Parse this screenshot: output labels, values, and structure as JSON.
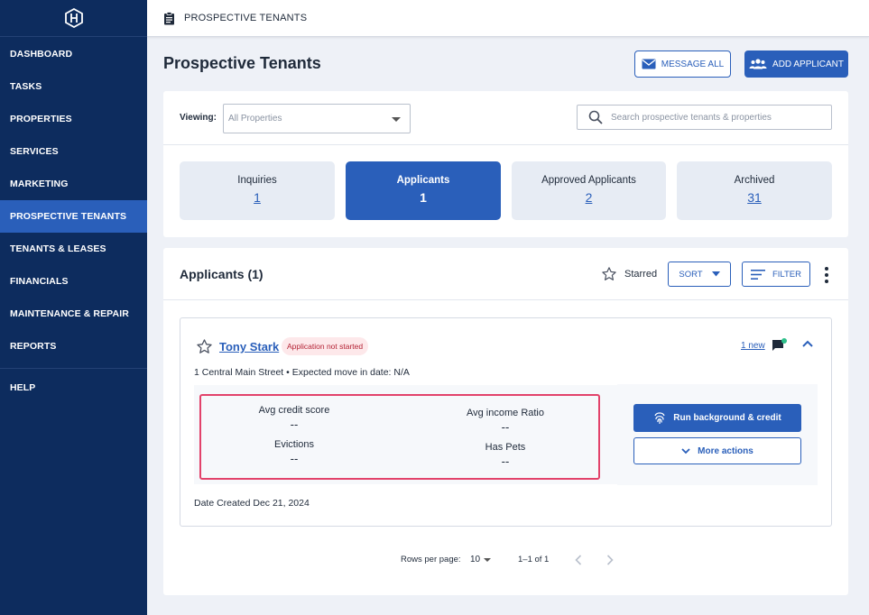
{
  "sidebar": {
    "items": [
      {
        "label": "DASHBOARD"
      },
      {
        "label": "TASKS"
      },
      {
        "label": "PROPERTIES"
      },
      {
        "label": "SERVICES"
      },
      {
        "label": "MARKETING"
      },
      {
        "label": "PROSPECTIVE TENANTS",
        "active": true
      },
      {
        "label": "TENANTS & LEASES"
      },
      {
        "label": "FINANCIALS"
      },
      {
        "label": "MAINTENANCE & REPAIR"
      },
      {
        "label": "REPORTS"
      }
    ],
    "help": "HELP"
  },
  "topbar": {
    "title": "PROSPECTIVE TENANTS"
  },
  "header": {
    "title": "Prospective Tenants",
    "message_all": "MESSAGE ALL",
    "add_applicant": "ADD APPLICANT"
  },
  "filters": {
    "viewing_label": "Viewing:",
    "viewing_value": "All Properties",
    "search_placeholder": "Search prospective tenants & properties"
  },
  "tabs": [
    {
      "label": "Inquiries",
      "count": "1"
    },
    {
      "label": "Applicants",
      "count": "1",
      "active": true
    },
    {
      "label": "Approved Applicants",
      "count": "2"
    },
    {
      "label": "Archived",
      "count": "31"
    }
  ],
  "applicants_section": {
    "title": "Applicants (1)",
    "starred": "Starred",
    "sort": "SORT",
    "filter": "FILTER"
  },
  "applicant": {
    "name": "Tony Stark",
    "status": "Application not started",
    "new_messages": "1 new",
    "address": "1 Central Main Street • Expected move in date: N/A",
    "stats": {
      "credit_label": "Avg credit score",
      "credit_value": "--",
      "evictions_label": "Evictions",
      "evictions_value": "--",
      "income_label": "Avg income Ratio",
      "income_value": "--",
      "pets_label": "Has Pets",
      "pets_value": "--"
    },
    "run_label": "Run background & credit",
    "more_label": "More actions",
    "date_created": "Date Created Dec 21, 2024"
  },
  "pagination": {
    "rows_label": "Rows per page:",
    "rows_value": "10",
    "range": "1–1 of 1"
  },
  "colors": {
    "sidebar": "#0d2c5e",
    "accent": "#2a5fba",
    "highlight": "#e2426a"
  }
}
